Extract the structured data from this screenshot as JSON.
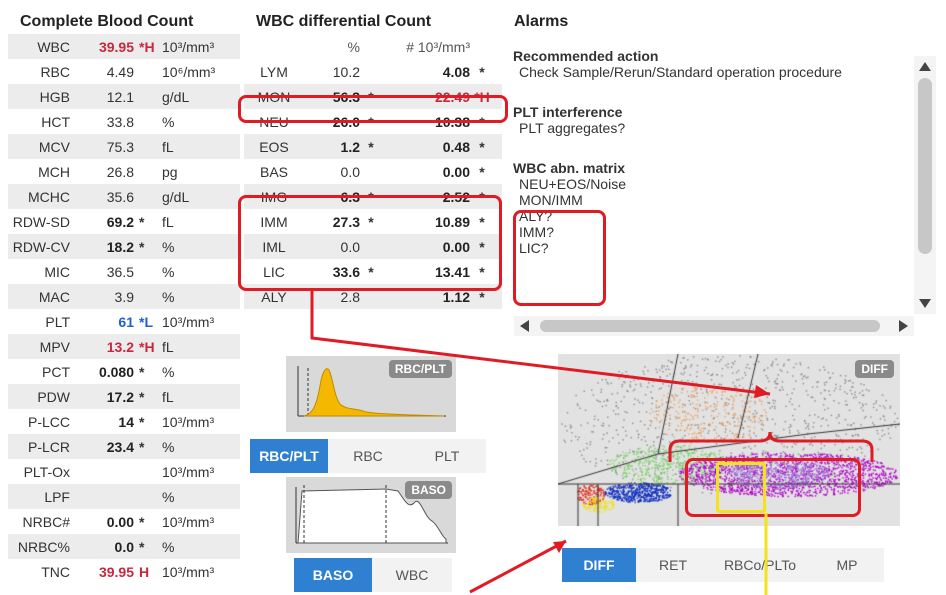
{
  "cbc": {
    "title": "Complete Blood Count",
    "rows": [
      {
        "name": "WBC",
        "value": "39.95",
        "flag": "*H",
        "unit": "10³/mm³",
        "style": "red"
      },
      {
        "name": "RBC",
        "value": "4.49",
        "flag": "",
        "unit": "10⁶/mm³",
        "style": ""
      },
      {
        "name": "HGB",
        "value": "12.1",
        "flag": "",
        "unit": "g/dL",
        "style": ""
      },
      {
        "name": "HCT",
        "value": "33.8",
        "flag": "",
        "unit": "%",
        "style": ""
      },
      {
        "name": "MCV",
        "value": "75.3",
        "flag": "",
        "unit": "fL",
        "style": ""
      },
      {
        "name": "MCH",
        "value": "26.8",
        "flag": "",
        "unit": "pg",
        "style": ""
      },
      {
        "name": "MCHC",
        "value": "35.6",
        "flag": "",
        "unit": "g/dL",
        "style": ""
      },
      {
        "name": "RDW-SD",
        "value": "69.2",
        "flag": "*",
        "unit": "fL",
        "style": "bold"
      },
      {
        "name": "RDW-CV",
        "value": "18.2",
        "flag": "*",
        "unit": "%",
        "style": "bold"
      },
      {
        "name": "MIC",
        "value": "36.5",
        "flag": "",
        "unit": "%",
        "style": ""
      },
      {
        "name": "MAC",
        "value": "3.9",
        "flag": "",
        "unit": "%",
        "style": ""
      },
      {
        "name": "PLT",
        "value": "61",
        "flag": "*L",
        "unit": "10³/mm³",
        "style": "blue"
      },
      {
        "name": "MPV",
        "value": "13.2",
        "flag": "*H",
        "unit": "fL",
        "style": "red"
      },
      {
        "name": "PCT",
        "value": "0.080",
        "flag": "*",
        "unit": "%",
        "style": "bold"
      },
      {
        "name": "PDW",
        "value": "17.2",
        "flag": "*",
        "unit": "fL",
        "style": "bold"
      },
      {
        "name": "P-LCC",
        "value": "14",
        "flag": "*",
        "unit": "10³/mm³",
        "style": "bold"
      },
      {
        "name": "P-LCR",
        "value": "23.4",
        "flag": "*",
        "unit": "%",
        "style": "bold"
      },
      {
        "name": "PLT-Ox",
        "value": "",
        "flag": "",
        "unit": "10³/mm³",
        "style": ""
      },
      {
        "name": "LPF",
        "value": "",
        "flag": "",
        "unit": "%",
        "style": ""
      },
      {
        "name": "NRBC#",
        "value": "0.00",
        "flag": "*",
        "unit": "10³/mm³",
        "style": "bold"
      },
      {
        "name": "NRBC%",
        "value": "0.0",
        "flag": "*",
        "unit": "%",
        "style": "bold"
      },
      {
        "name": "TNC",
        "value": "39.95",
        "flag": "H",
        "unit": "10³/mm³",
        "style": "red"
      }
    ]
  },
  "diff": {
    "title": "WBC differential Count",
    "col_pct": "%",
    "col_abs": "# 10³/mm³",
    "rows": [
      {
        "name": "LYM",
        "pct": "10.2",
        "pflag": "",
        "abs": "4.08",
        "aflag": "*",
        "pct_bold": false,
        "abs_style": "bold"
      },
      {
        "name": "MON",
        "pct": "56.3",
        "pflag": "*",
        "abs": "22.49",
        "aflag": "*H",
        "pct_bold": true,
        "abs_style": "red"
      },
      {
        "name": "NEU",
        "pct": "26.0",
        "pflag": "*",
        "abs": "10.38",
        "aflag": "*",
        "pct_bold": true,
        "abs_style": "bold"
      },
      {
        "name": "EOS",
        "pct": "1.2",
        "pflag": "*",
        "abs": "0.48",
        "aflag": "*",
        "pct_bold": true,
        "abs_style": "bold"
      },
      {
        "name": "BAS",
        "pct": "0.0",
        "pflag": "",
        "abs": "0.00",
        "aflag": "*",
        "pct_bold": false,
        "abs_style": "bold"
      },
      {
        "name": "IMG",
        "pct": "6.3",
        "pflag": "*",
        "abs": "2.52",
        "aflag": "*",
        "pct_bold": true,
        "abs_style": "bold"
      },
      {
        "name": "IMM",
        "pct": "27.3",
        "pflag": "*",
        "abs": "10.89",
        "aflag": "*",
        "pct_bold": true,
        "abs_style": "bold"
      },
      {
        "name": "IML",
        "pct": "0.0",
        "pflag": "",
        "abs": "0.00",
        "aflag": "*",
        "pct_bold": false,
        "abs_style": "bold"
      },
      {
        "name": "LIC",
        "pct": "33.6",
        "pflag": "*",
        "abs": "13.41",
        "aflag": "*",
        "pct_bold": true,
        "abs_style": "bold"
      },
      {
        "name": "ALY",
        "pct": "2.8",
        "pflag": "",
        "abs": "1.12",
        "aflag": "*",
        "pct_bold": false,
        "abs_style": "bold"
      }
    ]
  },
  "alarms": {
    "title": "Alarms",
    "sections": [
      {
        "heading": "Recommended action",
        "items": [
          "Check Sample/Rerun/Standard operation procedure"
        ]
      },
      {
        "heading": "PLT interference",
        "items": [
          "PLT aggregates?"
        ]
      },
      {
        "heading": "WBC abn. matrix",
        "items": [
          "NEU+EOS/Noise",
          "MON/IMM",
          "ALY?",
          "IMM?",
          "LIC?"
        ]
      }
    ]
  },
  "graphs": {
    "rbcplt_tag": "RBC/PLT",
    "baso_tag": "BASO",
    "tabs_top": [
      {
        "label": "RBC/PLT",
        "active": true
      },
      {
        "label": "RBC",
        "active": false
      },
      {
        "label": "PLT",
        "active": false
      }
    ],
    "tabs_bottom": [
      {
        "label": "BASO",
        "active": true
      },
      {
        "label": "WBC",
        "active": false
      }
    ]
  },
  "scatter": {
    "tag": "DIFF",
    "tabs": [
      {
        "label": "DIFF",
        "active": true
      },
      {
        "label": "RET",
        "active": false
      },
      {
        "label": "RBCo/PLTo",
        "active": false
      },
      {
        "label": "MP",
        "active": false
      }
    ]
  },
  "colors": {
    "accent": "#2f80d0",
    "high": "#c8283c",
    "low": "#1f5fcf",
    "annotation": "#e01b24",
    "highlight": "#f4e21a"
  }
}
